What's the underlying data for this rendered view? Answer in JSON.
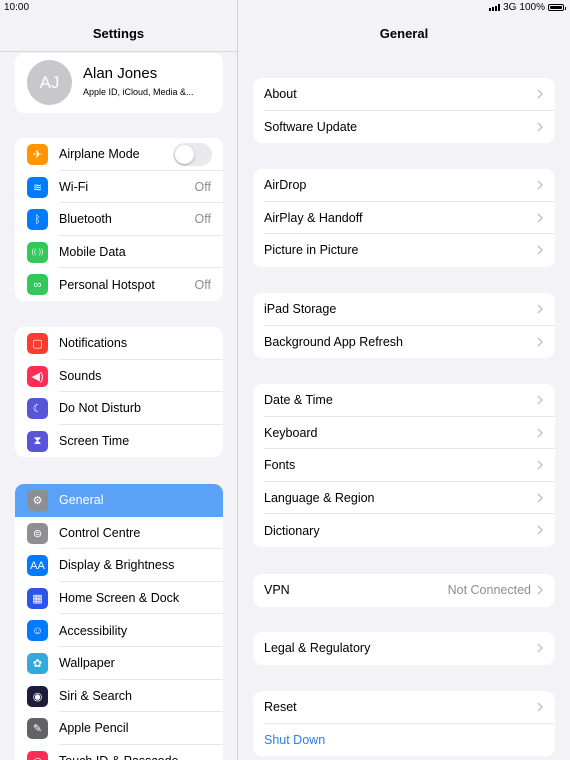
{
  "status": {
    "time": "10:00",
    "network": "3G",
    "battery": "100%"
  },
  "sidebar": {
    "title": "Settings",
    "profile": {
      "initials": "AJ",
      "name": "Alan Jones",
      "subtitle": "Apple ID, iCloud, Media &..."
    },
    "group1": [
      {
        "label": "Airplane Mode",
        "icon": "airplane-icon",
        "color": "#ff9500",
        "glyph": "✈",
        "toggle": false
      },
      {
        "label": "Wi-Fi",
        "icon": "wifi-icon",
        "color": "#007aff",
        "glyph": "≋",
        "value": "Off"
      },
      {
        "label": "Bluetooth",
        "icon": "bluetooth-icon",
        "color": "#007aff",
        "glyph": "ᛒ",
        "value": "Off"
      },
      {
        "label": "Mobile Data",
        "icon": "antenna-icon",
        "color": "#34c759",
        "glyph": "((·))"
      },
      {
        "label": "Personal Hotspot",
        "icon": "hotspot-icon",
        "color": "#34c759",
        "glyph": "∞",
        "value": "Off"
      }
    ],
    "group2": [
      {
        "label": "Notifications",
        "icon": "notifications-icon",
        "color": "#ff3b30",
        "glyph": "▢"
      },
      {
        "label": "Sounds",
        "icon": "speaker-icon",
        "color": "#ff2d55",
        "glyph": "◀)"
      },
      {
        "label": "Do Not Disturb",
        "icon": "moon-icon",
        "color": "#5856d6",
        "glyph": "☾"
      },
      {
        "label": "Screen Time",
        "icon": "hourglass-icon",
        "color": "#5856d6",
        "glyph": "⧗"
      }
    ],
    "group3": [
      {
        "label": "General",
        "icon": "gear-icon",
        "color": "#8e8e93",
        "glyph": "⚙",
        "selected": true
      },
      {
        "label": "Control Centre",
        "icon": "switches-icon",
        "color": "#8e8e93",
        "glyph": "⊜"
      },
      {
        "label": "Display & Brightness",
        "icon": "text-size-icon",
        "color": "#007aff",
        "glyph": "AA"
      },
      {
        "label": "Home Screen & Dock",
        "icon": "grid-icon",
        "color": "#2c55e8",
        "glyph": "▦"
      },
      {
        "label": "Accessibility",
        "icon": "accessibility-icon",
        "color": "#007aff",
        "glyph": "☺"
      },
      {
        "label": "Wallpaper",
        "icon": "flower-icon",
        "color": "#34aadc",
        "glyph": "✿"
      },
      {
        "label": "Siri & Search",
        "icon": "siri-icon",
        "color": "#1c1c3c",
        "glyph": "◉"
      },
      {
        "label": "Apple Pencil",
        "icon": "pencil-icon",
        "color": "#636366",
        "glyph": "✎"
      },
      {
        "label": "Touch ID & Passcode",
        "icon": "fingerprint-icon",
        "color": "#ff2d55",
        "glyph": "◎"
      }
    ]
  },
  "main": {
    "title": "General",
    "groups": [
      [
        {
          "label": "About"
        },
        {
          "label": "Software Update"
        }
      ],
      [
        {
          "label": "AirDrop"
        },
        {
          "label": "AirPlay & Handoff"
        },
        {
          "label": "Picture in Picture"
        }
      ],
      [
        {
          "label": "iPad Storage"
        },
        {
          "label": "Background App Refresh"
        }
      ],
      [
        {
          "label": "Date & Time"
        },
        {
          "label": "Keyboard"
        },
        {
          "label": "Fonts"
        },
        {
          "label": "Language & Region"
        },
        {
          "label": "Dictionary"
        }
      ],
      [
        {
          "label": "VPN",
          "value": "Not Connected"
        }
      ],
      [
        {
          "label": "Legal & Regulatory"
        }
      ],
      [
        {
          "label": "Reset"
        },
        {
          "label": "Shut Down",
          "action": true
        }
      ]
    ]
  }
}
